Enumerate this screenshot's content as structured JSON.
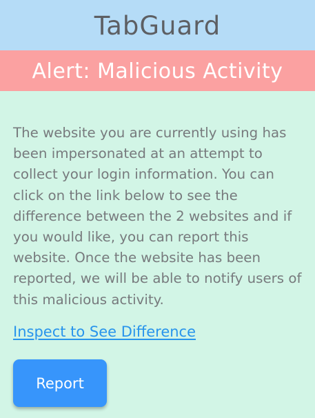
{
  "header": {
    "app_title": "TabGuard"
  },
  "alert": {
    "title": "Alert: Malicious Activity"
  },
  "main": {
    "message": "The website you are currently using has been impersonated at an attempt to collect your login information. You can click on the link below to see the difference between the 2 websites and if you would like, you can report this website. Once the website has been reported, we will be able to notify users of this malicious activity.",
    "inspect_link_label": "Inspect to See Difference",
    "report_button_label": "Report"
  },
  "colors": {
    "header_bg": "#b5dcf7",
    "alert_bg": "#fba1a1",
    "content_bg": "#d2f5e6",
    "link": "#2894ec",
    "button_bg": "#3795fb",
    "body_text": "#777a7d"
  }
}
